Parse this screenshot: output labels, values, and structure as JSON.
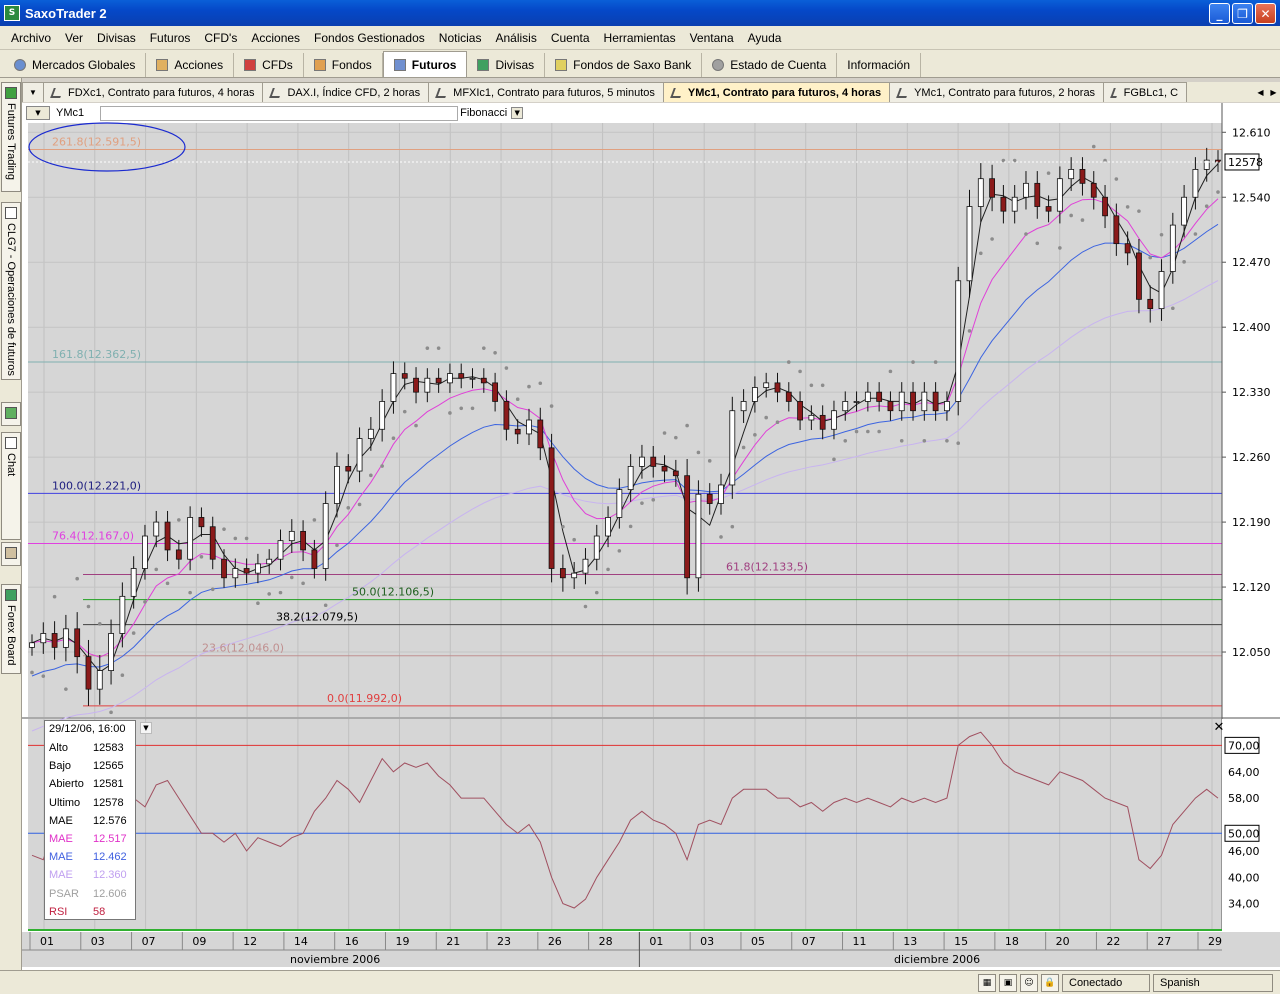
{
  "window": {
    "title": "SaxoTrader 2"
  },
  "menu": [
    "Archivo",
    "Ver",
    "Divisas",
    "Futuros",
    "CFD's",
    "Acciones",
    "Fondos Gestionados",
    "Noticias",
    "Análisis",
    "Cuenta",
    "Herramientas",
    "Ventana",
    "Ayuda"
  ],
  "modules": [
    "Mercados Globales",
    "Acciones",
    "CFDs",
    "Fondos",
    "Futuros",
    "Divisas",
    "Fondos de Saxo Bank",
    "Estado de Cuenta",
    "Información"
  ],
  "active_module": "Futuros",
  "side_tabs": [
    "Futures Trading",
    "CLG7 - Operaciones de futuros",
    "Chat",
    "Forex Board"
  ],
  "chart_tabs": [
    "FDXc1, Contrato para futuros, 4 horas",
    "DAX.I, Índice CFD, 2 horas",
    "MFXIc1, Contrato para futuros, 5 minutos",
    "YMc1, Contrato para futuros, 4 horas",
    "YMc1, Contrato para futuros, 2 horas",
    "FGBLc1, C"
  ],
  "active_chart_tab": "YMc1, Contrato para futuros, 4 horas",
  "toolbar": {
    "symbol": "YMc1",
    "study": "Fibonacci"
  },
  "info": {
    "date": "29/12/06, 16:00",
    "rows": [
      {
        "k": "Alto",
        "v": "12583",
        "color": "#000000"
      },
      {
        "k": "Bajo",
        "v": "12565",
        "color": "#000000"
      },
      {
        "k": "Abierto",
        "v": "12581",
        "color": "#000000"
      },
      {
        "k": "Ultimo",
        "v": "12578",
        "color": "#000000"
      },
      {
        "k": "MAE",
        "v": "12.576",
        "color": "#000000"
      },
      {
        "k": "MAE",
        "v": "12.517",
        "color": "#e030c8"
      },
      {
        "k": "MAE",
        "v": "12.462",
        "color": "#4060e0"
      },
      {
        "k": "MAE",
        "v": "12.360",
        "color": "#c0a0f0"
      },
      {
        "k": "PSAR",
        "v": "12.606",
        "color": "#a0a0a0"
      },
      {
        "k": "RSI",
        "v": "58",
        "color": "#c02040"
      }
    ]
  },
  "status": {
    "connection": "Conectado",
    "language": "Spanish"
  },
  "chart_data": {
    "type": "candlestick",
    "price_ylim": [
      11980,
      12620
    ],
    "price_ticks": [
      "12.610",
      "12.540",
      "12.470",
      "12.400",
      "12.330",
      "12.260",
      "12.190",
      "12.120",
      "12.050"
    ],
    "last_price_label": "12578",
    "fibonacci": [
      {
        "label": "261.8(12.591,5)",
        "value": 12591.5,
        "color": "#e0a080"
      },
      {
        "label": "161.8(12.362,5)",
        "value": 12362.5,
        "color": "#80b0b0"
      },
      {
        "label": "100.0(12.221,0)",
        "value": 12221.0,
        "color": "#4040e0"
      },
      {
        "label": "76.4(12.167,0)",
        "value": 12167.0,
        "color": "#e040e0"
      },
      {
        "label": "61.8(12.133,5)",
        "value": 12133.5,
        "color": "#a04080"
      },
      {
        "label": "50.0(12.106,5)",
        "value": 12106.5,
        "color": "#20a020"
      },
      {
        "label": "38.2(12.079,5)",
        "value": 12079.5,
        "color": "#404040"
      },
      {
        "label": "23.6(12.046,0)",
        "value": 12046.0,
        "color": "#c09090"
      },
      {
        "label": "0.0(11.992,0)",
        "value": 11992.0,
        "color": "#e04040"
      }
    ],
    "close": [
      12060,
      12070,
      12055,
      12075,
      12045,
      12010,
      12030,
      12070,
      12110,
      12140,
      12175,
      12190,
      12160,
      12150,
      12195,
      12185,
      12150,
      12130,
      12140,
      12135,
      12145,
      12150,
      12170,
      12180,
      12160,
      12140,
      12210,
      12250,
      12245,
      12280,
      12290,
      12320,
      12350,
      12345,
      12330,
      12345,
      12340,
      12350,
      12345,
      12345,
      12340,
      12320,
      12290,
      12285,
      12300,
      12270,
      12140,
      12130,
      12135,
      12150,
      12175,
      12195,
      12225,
      12250,
      12260,
      12250,
      12245,
      12240,
      12130,
      12220,
      12210,
      12230,
      12310,
      12320,
      12335,
      12340,
      12330,
      12320,
      12300,
      12305,
      12290,
      12310,
      12320,
      12320,
      12330,
      12320,
      12310,
      12330,
      12310,
      12330,
      12310,
      12320,
      12450,
      12530,
      12560,
      12540,
      12525,
      12540,
      12555,
      12530,
      12525,
      12560,
      12570,
      12555,
      12540,
      12520,
      12490,
      12480,
      12430,
      12420,
      12460,
      12510,
      12540,
      12570,
      12580,
      12578
    ],
    "volatility": [
      15,
      20,
      22,
      25,
      30,
      30,
      28,
      25,
      25,
      22,
      20,
      20,
      20,
      18,
      20,
      18,
      18,
      18,
      18,
      18,
      18,
      18,
      20,
      22,
      20,
      18,
      22,
      25,
      22,
      20,
      22,
      22,
      22,
      20,
      20,
      18,
      18,
      18,
      18,
      18,
      18,
      18,
      20,
      18,
      20,
      22,
      25,
      25,
      20,
      20,
      20,
      20,
      20,
      22,
      22,
      20,
      20,
      20,
      30,
      25,
      20,
      20,
      25,
      22,
      20,
      18,
      18,
      18,
      18,
      18,
      18,
      18,
      18,
      18,
      18,
      18,
      18,
      18,
      18,
      18,
      18,
      18,
      25,
      30,
      28,
      25,
      22,
      22,
      22,
      22,
      20,
      22,
      22,
      22,
      22,
      22,
      22,
      22,
      25,
      25,
      22,
      22,
      22,
      22,
      22,
      18
    ],
    "psar_offsets": [
      1,
      -1
    ],
    "x_dates": [
      "01",
      "03",
      "07",
      "09",
      "12",
      "14",
      "16",
      "19",
      "21",
      "23",
      "26",
      "28",
      "01",
      "03",
      "05",
      "07",
      "11",
      "13",
      "15",
      "18",
      "20",
      "22",
      "27",
      "29"
    ],
    "months": [
      "noviembre 2006",
      "diciembre 2006"
    ],
    "rsi": {
      "ylim": [
        28,
        76
      ],
      "ticks": [
        "70,00",
        "64,00",
        "58,00",
        "50,00",
        "46,00",
        "40,00",
        "34,00"
      ],
      "overbought": 70,
      "oversold": 50,
      "values": [
        45,
        44,
        52,
        56,
        48,
        48,
        62,
        60,
        63,
        58,
        56,
        61,
        62,
        58,
        54,
        50,
        50,
        48,
        50,
        46,
        49,
        48,
        47,
        49,
        50,
        55,
        58,
        62,
        60,
        57,
        62,
        67,
        64,
        66,
        65,
        66,
        63,
        61,
        58,
        58,
        58,
        55,
        52,
        50,
        52,
        48,
        40,
        34,
        33,
        35,
        40,
        44,
        48,
        53,
        55,
        53,
        52,
        50,
        44,
        52,
        53,
        52,
        58,
        60,
        60,
        60,
        58,
        58,
        56,
        57,
        55,
        57,
        58,
        57,
        58,
        57,
        56,
        58,
        57,
        58,
        57,
        58,
        70,
        72,
        73,
        70,
        66,
        64,
        63,
        62,
        61,
        64,
        63,
        62,
        60,
        58,
        57,
        56,
        44,
        42,
        45,
        52,
        55,
        58,
        60,
        58
      ]
    }
  }
}
